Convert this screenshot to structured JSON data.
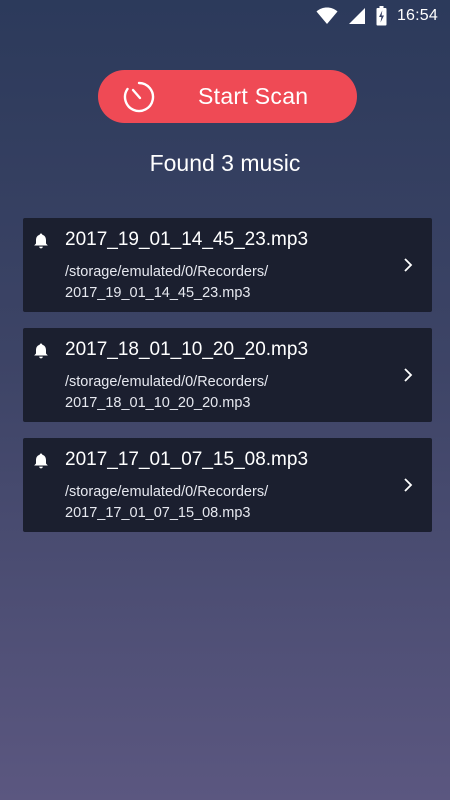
{
  "status_bar": {
    "time": "16:54",
    "icons": [
      "wifi-icon",
      "cell-signal-icon",
      "battery-icon"
    ]
  },
  "scan_button": {
    "label": "Start Scan",
    "icon": "timer-icon",
    "color": "#ef4a55"
  },
  "found_text": "Found 3 music",
  "files": [
    {
      "name": "2017_19_01_14_45_23.mp3",
      "path_dir": "/storage/emulated/0/Recorders/",
      "path_file": "2017_19_01_14_45_23.mp3",
      "icon": "bell-icon"
    },
    {
      "name": "2017_18_01_10_20_20.mp3",
      "path_dir": "/storage/emulated/0/Recorders/",
      "path_file": "2017_18_01_10_20_20.mp3",
      "icon": "bell-icon"
    },
    {
      "name": "2017_17_01_07_15_08.mp3",
      "path_dir": "/storage/emulated/0/Recorders/",
      "path_file": "2017_17_01_07_15_08.mp3",
      "icon": "bell-icon"
    }
  ],
  "colors": {
    "background_top": "#2c3a5b",
    "background_bottom": "#5b5780",
    "card_background": "#1b1f2f"
  }
}
